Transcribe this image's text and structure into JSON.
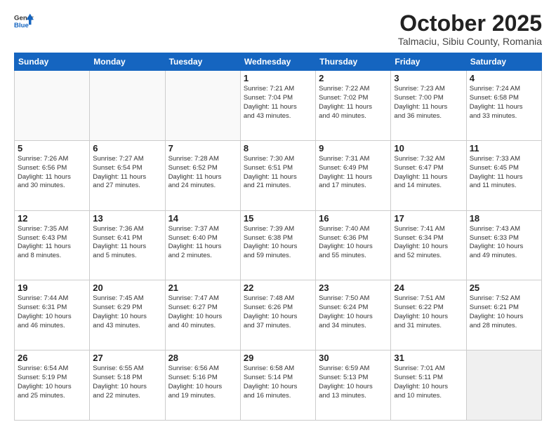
{
  "header": {
    "logo_general": "General",
    "logo_blue": "Blue",
    "month_title": "October 2025",
    "subtitle": "Talmaciu, Sibiu County, Romania"
  },
  "days_of_week": [
    "Sunday",
    "Monday",
    "Tuesday",
    "Wednesday",
    "Thursday",
    "Friday",
    "Saturday"
  ],
  "weeks": [
    [
      {
        "day": "",
        "lines": []
      },
      {
        "day": "",
        "lines": []
      },
      {
        "day": "",
        "lines": []
      },
      {
        "day": "1",
        "lines": [
          "Sunrise: 7:21 AM",
          "Sunset: 7:04 PM",
          "Daylight: 11 hours",
          "and 43 minutes."
        ]
      },
      {
        "day": "2",
        "lines": [
          "Sunrise: 7:22 AM",
          "Sunset: 7:02 PM",
          "Daylight: 11 hours",
          "and 40 minutes."
        ]
      },
      {
        "day": "3",
        "lines": [
          "Sunrise: 7:23 AM",
          "Sunset: 7:00 PM",
          "Daylight: 11 hours",
          "and 36 minutes."
        ]
      },
      {
        "day": "4",
        "lines": [
          "Sunrise: 7:24 AM",
          "Sunset: 6:58 PM",
          "Daylight: 11 hours",
          "and 33 minutes."
        ]
      }
    ],
    [
      {
        "day": "5",
        "lines": [
          "Sunrise: 7:26 AM",
          "Sunset: 6:56 PM",
          "Daylight: 11 hours",
          "and 30 minutes."
        ]
      },
      {
        "day": "6",
        "lines": [
          "Sunrise: 7:27 AM",
          "Sunset: 6:54 PM",
          "Daylight: 11 hours",
          "and 27 minutes."
        ]
      },
      {
        "day": "7",
        "lines": [
          "Sunrise: 7:28 AM",
          "Sunset: 6:52 PM",
          "Daylight: 11 hours",
          "and 24 minutes."
        ]
      },
      {
        "day": "8",
        "lines": [
          "Sunrise: 7:30 AM",
          "Sunset: 6:51 PM",
          "Daylight: 11 hours",
          "and 21 minutes."
        ]
      },
      {
        "day": "9",
        "lines": [
          "Sunrise: 7:31 AM",
          "Sunset: 6:49 PM",
          "Daylight: 11 hours",
          "and 17 minutes."
        ]
      },
      {
        "day": "10",
        "lines": [
          "Sunrise: 7:32 AM",
          "Sunset: 6:47 PM",
          "Daylight: 11 hours",
          "and 14 minutes."
        ]
      },
      {
        "day": "11",
        "lines": [
          "Sunrise: 7:33 AM",
          "Sunset: 6:45 PM",
          "Daylight: 11 hours",
          "and 11 minutes."
        ]
      }
    ],
    [
      {
        "day": "12",
        "lines": [
          "Sunrise: 7:35 AM",
          "Sunset: 6:43 PM",
          "Daylight: 11 hours",
          "and 8 minutes."
        ]
      },
      {
        "day": "13",
        "lines": [
          "Sunrise: 7:36 AM",
          "Sunset: 6:41 PM",
          "Daylight: 11 hours",
          "and 5 minutes."
        ]
      },
      {
        "day": "14",
        "lines": [
          "Sunrise: 7:37 AM",
          "Sunset: 6:40 PM",
          "Daylight: 11 hours",
          "and 2 minutes."
        ]
      },
      {
        "day": "15",
        "lines": [
          "Sunrise: 7:39 AM",
          "Sunset: 6:38 PM",
          "Daylight: 10 hours",
          "and 59 minutes."
        ]
      },
      {
        "day": "16",
        "lines": [
          "Sunrise: 7:40 AM",
          "Sunset: 6:36 PM",
          "Daylight: 10 hours",
          "and 55 minutes."
        ]
      },
      {
        "day": "17",
        "lines": [
          "Sunrise: 7:41 AM",
          "Sunset: 6:34 PM",
          "Daylight: 10 hours",
          "and 52 minutes."
        ]
      },
      {
        "day": "18",
        "lines": [
          "Sunrise: 7:43 AM",
          "Sunset: 6:33 PM",
          "Daylight: 10 hours",
          "and 49 minutes."
        ]
      }
    ],
    [
      {
        "day": "19",
        "lines": [
          "Sunrise: 7:44 AM",
          "Sunset: 6:31 PM",
          "Daylight: 10 hours",
          "and 46 minutes."
        ]
      },
      {
        "day": "20",
        "lines": [
          "Sunrise: 7:45 AM",
          "Sunset: 6:29 PM",
          "Daylight: 10 hours",
          "and 43 minutes."
        ]
      },
      {
        "day": "21",
        "lines": [
          "Sunrise: 7:47 AM",
          "Sunset: 6:27 PM",
          "Daylight: 10 hours",
          "and 40 minutes."
        ]
      },
      {
        "day": "22",
        "lines": [
          "Sunrise: 7:48 AM",
          "Sunset: 6:26 PM",
          "Daylight: 10 hours",
          "and 37 minutes."
        ]
      },
      {
        "day": "23",
        "lines": [
          "Sunrise: 7:50 AM",
          "Sunset: 6:24 PM",
          "Daylight: 10 hours",
          "and 34 minutes."
        ]
      },
      {
        "day": "24",
        "lines": [
          "Sunrise: 7:51 AM",
          "Sunset: 6:22 PM",
          "Daylight: 10 hours",
          "and 31 minutes."
        ]
      },
      {
        "day": "25",
        "lines": [
          "Sunrise: 7:52 AM",
          "Sunset: 6:21 PM",
          "Daylight: 10 hours",
          "and 28 minutes."
        ]
      }
    ],
    [
      {
        "day": "26",
        "lines": [
          "Sunrise: 6:54 AM",
          "Sunset: 5:19 PM",
          "Daylight: 10 hours",
          "and 25 minutes."
        ]
      },
      {
        "day": "27",
        "lines": [
          "Sunrise: 6:55 AM",
          "Sunset: 5:18 PM",
          "Daylight: 10 hours",
          "and 22 minutes."
        ]
      },
      {
        "day": "28",
        "lines": [
          "Sunrise: 6:56 AM",
          "Sunset: 5:16 PM",
          "Daylight: 10 hours",
          "and 19 minutes."
        ]
      },
      {
        "day": "29",
        "lines": [
          "Sunrise: 6:58 AM",
          "Sunset: 5:14 PM",
          "Daylight: 10 hours",
          "and 16 minutes."
        ]
      },
      {
        "day": "30",
        "lines": [
          "Sunrise: 6:59 AM",
          "Sunset: 5:13 PM",
          "Daylight: 10 hours",
          "and 13 minutes."
        ]
      },
      {
        "day": "31",
        "lines": [
          "Sunrise: 7:01 AM",
          "Sunset: 5:11 PM",
          "Daylight: 10 hours",
          "and 10 minutes."
        ]
      },
      {
        "day": "",
        "lines": []
      }
    ]
  ]
}
